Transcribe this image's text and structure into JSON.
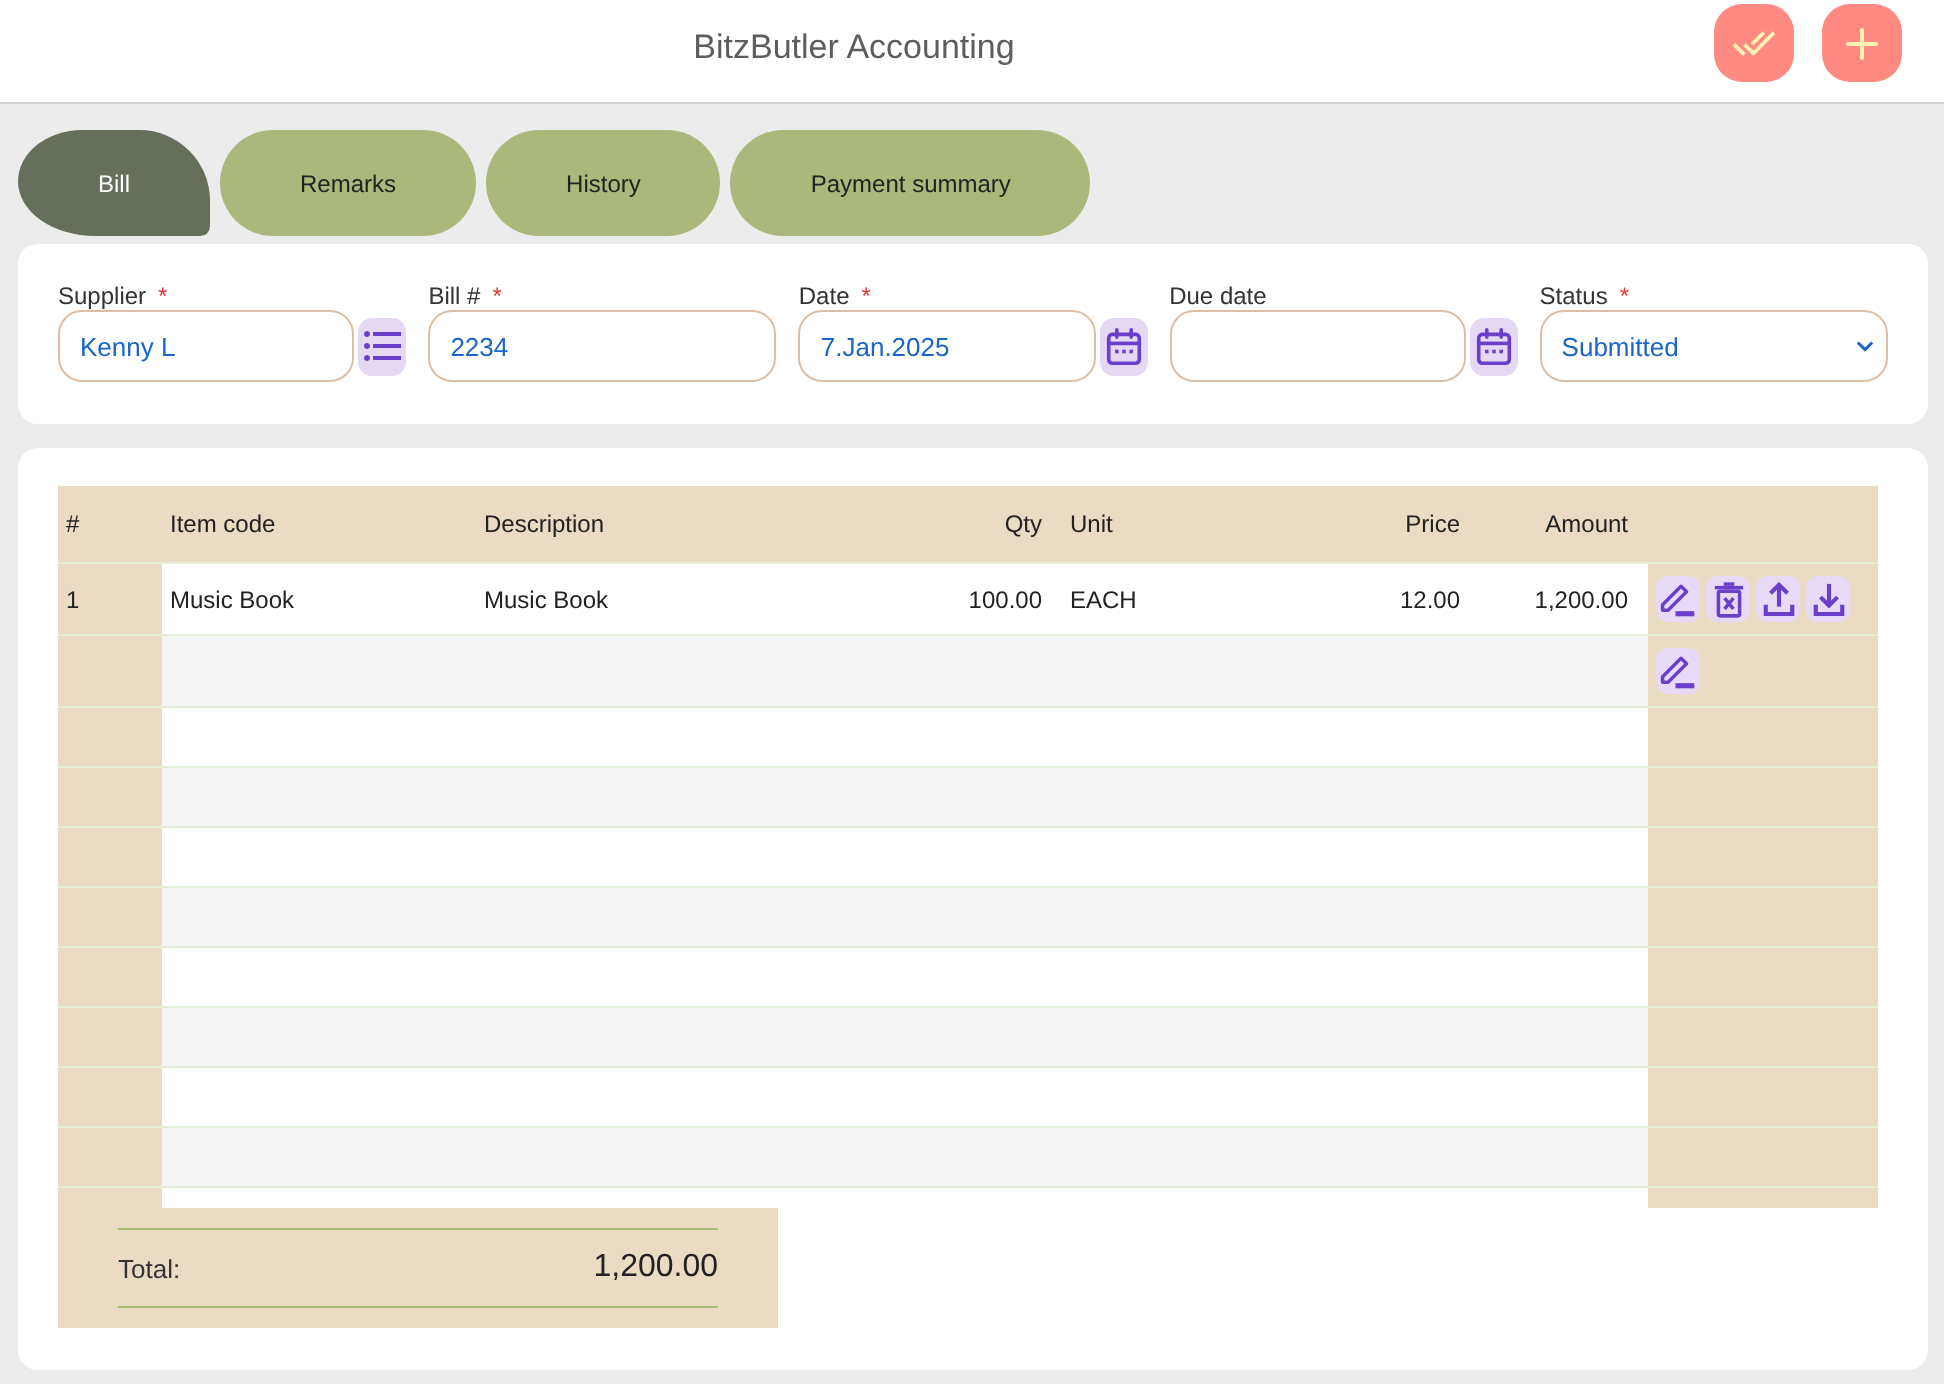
{
  "header": {
    "title": "BitzButler Accounting"
  },
  "tabs": [
    {
      "label": "Bill",
      "selected": true
    },
    {
      "label": "Remarks",
      "selected": false
    },
    {
      "label": "History",
      "selected": false
    },
    {
      "label": "Payment summary",
      "selected": false
    }
  ],
  "bill_form": {
    "fields": [
      {
        "kind": "lookup",
        "label": "Supplier",
        "required_mark": "*",
        "value": "Kenny L"
      },
      {
        "kind": "text",
        "label": "Bill #",
        "required_mark": "*",
        "value": "2234"
      },
      {
        "kind": "date",
        "label": "Date",
        "required_mark": "*",
        "value": "7.Jan.2025"
      },
      {
        "kind": "date",
        "label": "Due date"
      },
      {
        "kind": "select",
        "label": "Status",
        "required_mark": "*",
        "value": "Submitted"
      }
    ]
  },
  "line_items": {
    "columns": [
      "#",
      "Item code",
      "Description",
      "Qty",
      "Unit",
      "Price",
      "Amount"
    ],
    "rows": [
      {
        "kind": "item",
        "cells": [
          "1",
          "Music Book",
          "Music Book",
          "100.00",
          "EACH",
          "12.00",
          "1,200.00"
        ]
      },
      {
        "kind": "new"
      }
    ]
  },
  "total": {
    "label": "Total:",
    "value": "1,200.00"
  }
}
